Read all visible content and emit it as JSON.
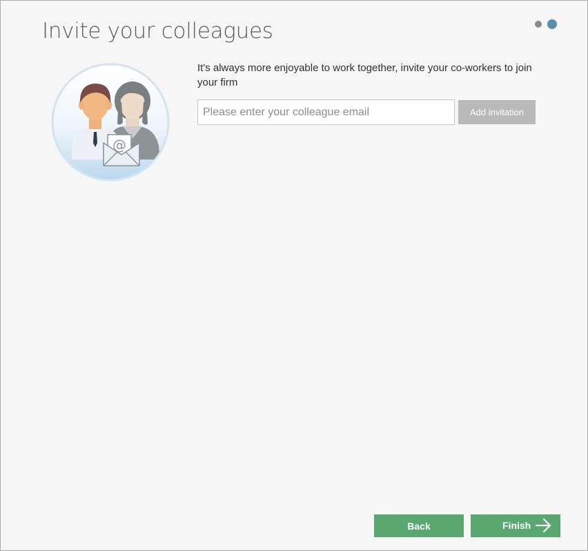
{
  "page": {
    "title": "Invite your colleagues",
    "intro_text": "It's always more enjoyable to work together, invite your co-workers to join your firm"
  },
  "steps": {
    "total": 2,
    "current": 2
  },
  "invite_form": {
    "email_placeholder": "Please enter your colleague email",
    "email_value": "",
    "add_label": "Add invitation"
  },
  "footer": {
    "back_label": "Back",
    "finish_label": "Finish"
  },
  "icons": {
    "illustration": "colleagues-invitation-icon",
    "finish_arrow": "arrow-right-icon"
  },
  "colors": {
    "accent_green": "#5aa870",
    "disabled_gray": "#b9b9b9",
    "active_step": "#5a8fb0",
    "inactive_step": "#8a8a8a"
  }
}
